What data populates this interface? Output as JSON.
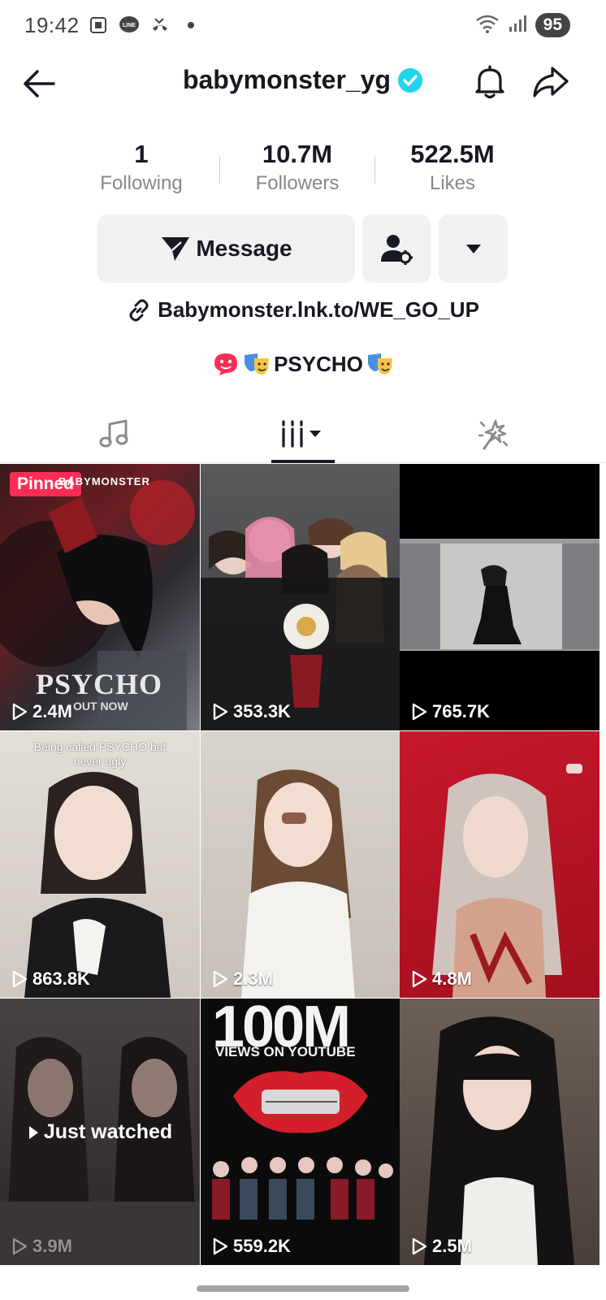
{
  "status": {
    "time": "19:42",
    "battery": "95"
  },
  "header": {
    "username": "babymonster_yg"
  },
  "stats": [
    {
      "value": "1",
      "label": "Following"
    },
    {
      "value": "10.7M",
      "label": "Followers"
    },
    {
      "value": "522.5M",
      "label": "Likes"
    }
  ],
  "actions": {
    "message_label": "Message"
  },
  "bio": {
    "link": "Babymonster.lnk.to/WE_GO_UP",
    "line": "PSYCHO"
  },
  "tabs": [
    {
      "icon": "music-note-icon"
    },
    {
      "icon": "videos-grid-icon",
      "active": true
    },
    {
      "icon": "reposts-sparkle-icon"
    }
  ],
  "grid": {
    "pinned_label": "Pinned",
    "just_watched_label": "Just watched",
    "videos": [
      {
        "views": "2.4M",
        "pinned": true,
        "caption": "PSYCHO",
        "subcaption": "OUT NOW",
        "brand": "BABYMONSTER"
      },
      {
        "views": "353.3K"
      },
      {
        "views": "765.7K"
      },
      {
        "views": "863.8K",
        "caption": "Being called PSYCHO but never ugly"
      },
      {
        "views": "2.3M"
      },
      {
        "views": "4.8M"
      },
      {
        "views": "3.9M",
        "just_watched": true
      },
      {
        "views": "559.2K",
        "caption": "100M",
        "subcaption": "VIEWS ON YOUTUBE"
      },
      {
        "views": "2.5M"
      }
    ]
  },
  "colors": {
    "accent": "#fe2c55",
    "verified": "#20d5ec",
    "button_bg": "#f1f1f2"
  }
}
